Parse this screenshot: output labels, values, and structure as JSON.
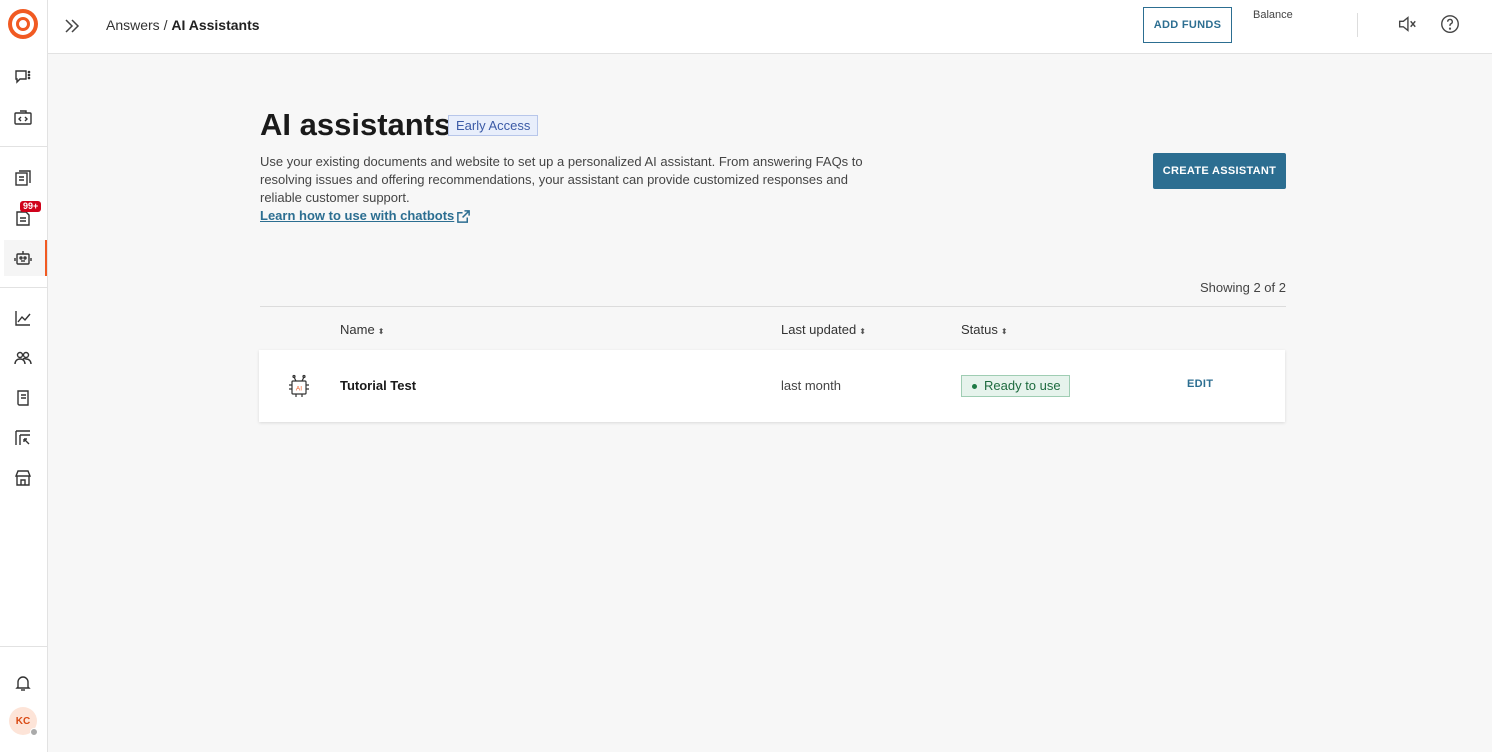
{
  "sidebar": {
    "logo": "brand-logo",
    "icons": [
      "chat-icon",
      "code-icon",
      "answers-icon",
      "tickets-icon",
      "ai-assistant-icon",
      "analytics-icon",
      "people-icon",
      "book-icon",
      "flow-icon",
      "store-icon",
      "bell-icon"
    ],
    "badge": "99+",
    "avatar": "KC"
  },
  "topbar": {
    "breadcrumb_parent": "Answers",
    "breadcrumb_separator": "/",
    "breadcrumb_current": "AI Assistants",
    "add_funds": "ADD FUNDS",
    "balance_label": "Balance"
  },
  "main": {
    "title": "AI assistants",
    "badge": "Early Access",
    "description": "Use your existing documents and website to set up a personalized AI assistant. From answering FAQs to resolving issues and offering recommendations, your assistant can provide customized responses and reliable customer support.",
    "learn_link": "Learn how to use with chatbots",
    "create_button": "CREATE ASSISTANT",
    "showing": "Showing 2 of 2"
  },
  "table": {
    "columns": [
      "Name",
      "Last updated",
      "Status"
    ],
    "sort_glyph": "⬍",
    "rows": [
      {
        "icon_text": "AI",
        "name": "Tutorial Test",
        "last_updated": "last month",
        "status": "Ready to use",
        "action": "EDIT"
      }
    ]
  },
  "colors": {
    "accent": "#f15a22",
    "primary": "#2c6e91",
    "status_green": "#1e6b3f",
    "badge_red": "#d0021b"
  }
}
